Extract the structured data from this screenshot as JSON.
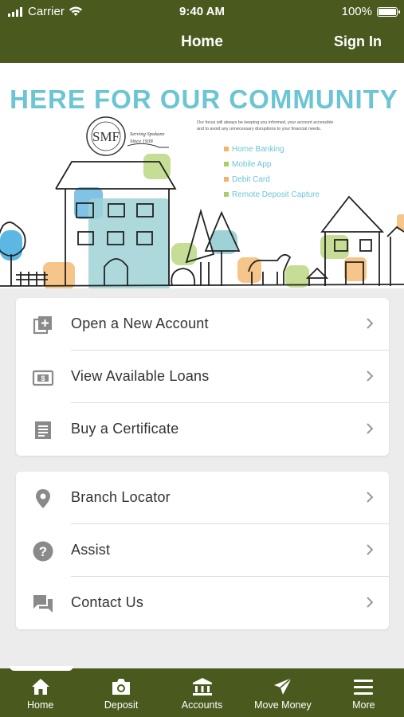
{
  "status": {
    "carrier": "Carrier",
    "time": "9:40 AM",
    "battery": "100%"
  },
  "nav": {
    "title": "Home",
    "sign_in": "Sign In"
  },
  "banner": {
    "headline": "HERE FOR OUR COMMUNITY",
    "blurb_1": "Our focus will always be keeping you informed, your account accessible",
    "blurb_2": "and to avoid any unnecessary disruptions to your financial needs.",
    "logo_text": "SMF",
    "tagline_1": "Serving Spokane",
    "tagline_2": "Since 1938",
    "bullets": [
      "Home Banking",
      "Mobile App",
      "Debit Card",
      "Remote Deposit Capture"
    ],
    "bullet_colors": [
      "#f5b26b",
      "#a9cf6a",
      "#f5b26b",
      "#a9cf6a"
    ]
  },
  "menu_group_1": [
    {
      "label": "Open a New Account",
      "icon": "add-box-icon"
    },
    {
      "label": "View Available Loans",
      "icon": "money-icon"
    },
    {
      "label": "Buy a Certificate",
      "icon": "certificate-icon"
    }
  ],
  "menu_group_2": [
    {
      "label": "Branch Locator",
      "icon": "location-pin-icon"
    },
    {
      "label": "Assist",
      "icon": "help-icon"
    },
    {
      "label": "Contact Us",
      "icon": "chat-icon"
    }
  ],
  "tabs": [
    {
      "label": "Home",
      "icon": "home-icon"
    },
    {
      "label": "Deposit",
      "icon": "camera-icon"
    },
    {
      "label": "Accounts",
      "icon": "bank-icon"
    },
    {
      "label": "Move Money",
      "icon": "send-icon"
    },
    {
      "label": "More",
      "icon": "menu-icon"
    }
  ],
  "colors": {
    "brand": "#4a5a1e",
    "headline": "#6cc5d3",
    "icon_gray": "#8a8a8a"
  }
}
